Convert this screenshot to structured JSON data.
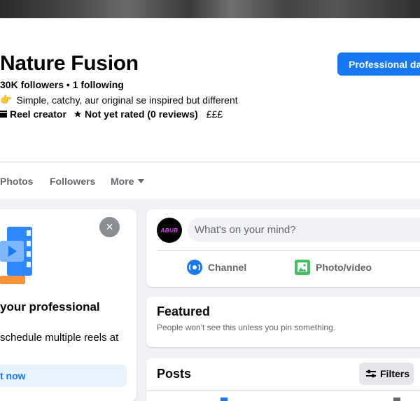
{
  "page": {
    "name": "Nature Fusion",
    "stats": "30K followers • 1 following",
    "bio_emoji": "👉",
    "bio": "Simple, catchy, aur original se inspired but different",
    "category": "Reel creator",
    "rating": "Not yet rated (0 reviews)",
    "price": "£££",
    "professional_button": "Professional dashboard"
  },
  "tabs": [
    {
      "label": "Photos"
    },
    {
      "label": "Followers"
    },
    {
      "label": "More"
    }
  ],
  "promo": {
    "close_icon": "×",
    "title": "your professional",
    "text": "schedule multiple reels at",
    "cta": "t now"
  },
  "composer": {
    "avatar_text": "ABUB",
    "placeholder": "What's on your mind?",
    "actions": [
      {
        "label": "Channel",
        "icon": "channel-icon",
        "color": "#1877f2"
      },
      {
        "label": "Photo/video",
        "icon": "photo-video-icon",
        "color": "#45bd62"
      }
    ]
  },
  "featured": {
    "title": "Featured",
    "subtitle": "People won't see this unless you pin something."
  },
  "posts": {
    "title": "Posts",
    "filters_label": "Filters"
  },
  "colors": {
    "accent": "#1877f2",
    "background": "#f0f2f5",
    "muted_text": "#65676b"
  }
}
